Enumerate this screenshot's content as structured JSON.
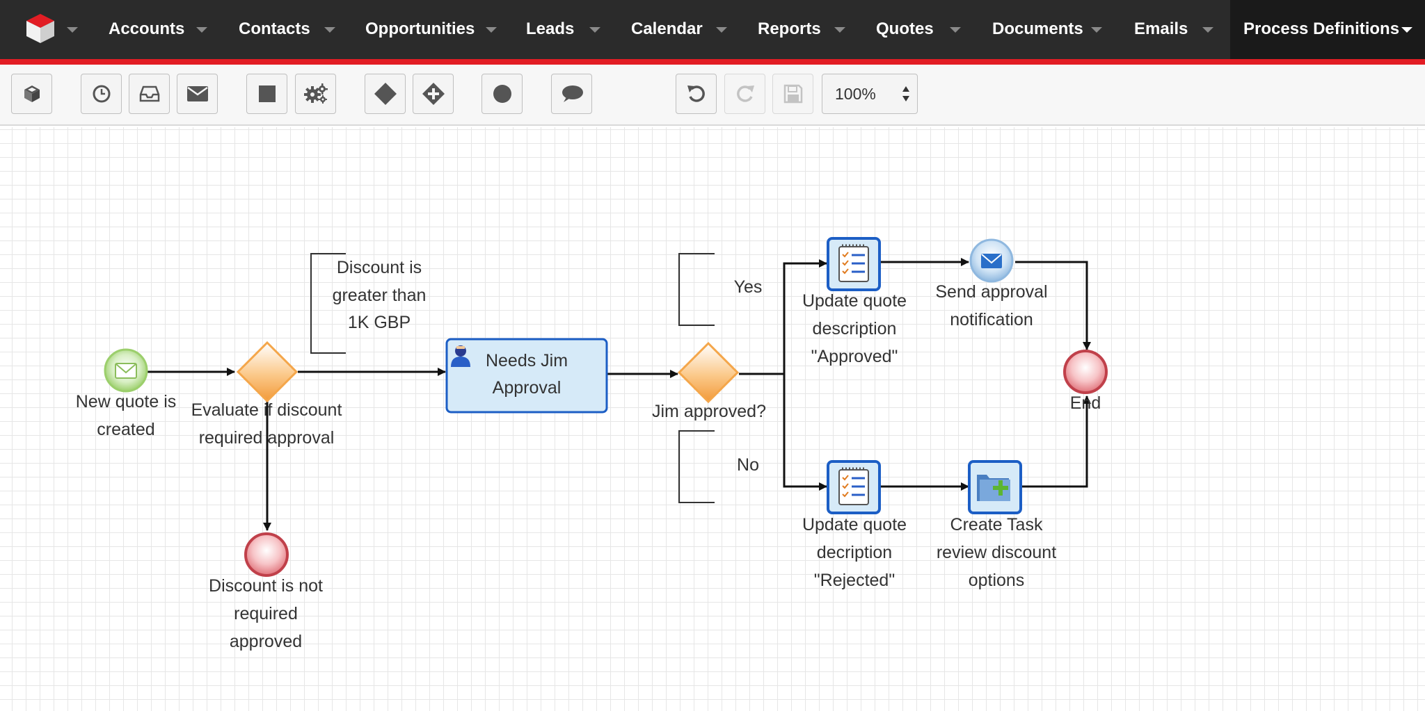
{
  "nav": {
    "items": [
      {
        "label": "Accounts"
      },
      {
        "label": "Contacts"
      },
      {
        "label": "Opportunities"
      },
      {
        "label": "Leads"
      },
      {
        "label": "Calendar"
      },
      {
        "label": "Reports"
      },
      {
        "label": "Quotes"
      },
      {
        "label": "Documents"
      },
      {
        "label": "Emails"
      },
      {
        "label": "Process Definitions"
      }
    ],
    "active": "Process Definitions",
    "accent_color": "#e21d24"
  },
  "toolbar": {
    "zoom": "100%",
    "buttons": [
      "cube-icon",
      "clock-icon",
      "inbox-icon",
      "envelope-icon",
      "square-icon",
      "gears-icon",
      "diamond-icon",
      "diamond-plus-icon",
      "circle-icon",
      "comment-icon",
      "undo-icon",
      "redo-icon",
      "save-icon"
    ]
  },
  "diagram": {
    "start": {
      "label_1": "New quote is",
      "label_2": "created"
    },
    "gateway1": {
      "label_1": "Evaluate if discount",
      "label_2": "required approval"
    },
    "end1": {
      "label_1": "Discount is not",
      "label_2": "required",
      "label_3": "approved"
    },
    "annotation1": {
      "line_1": "Discount is",
      "line_2": "greater than",
      "line_3": "1K GBP"
    },
    "task_jim": {
      "line_1": "Needs Jim",
      "line_2": "Approval"
    },
    "gateway2": {
      "label": "Jim approved?"
    },
    "annotation_yes": {
      "label": "Yes"
    },
    "annotation_no": {
      "label": "No"
    },
    "task_approved": {
      "line_1": "Update quote",
      "line_2": "description",
      "line_3": "\"Approved\""
    },
    "task_rejected": {
      "line_1": "Update quote",
      "line_2": "decription",
      "line_3": "\"Rejected\""
    },
    "send_notification": {
      "line_1": "Send approval",
      "line_2": "notification"
    },
    "create_task": {
      "line_1": "Create Task",
      "line_2": "review discount",
      "line_3": "options"
    },
    "end2": {
      "label": "End"
    }
  }
}
